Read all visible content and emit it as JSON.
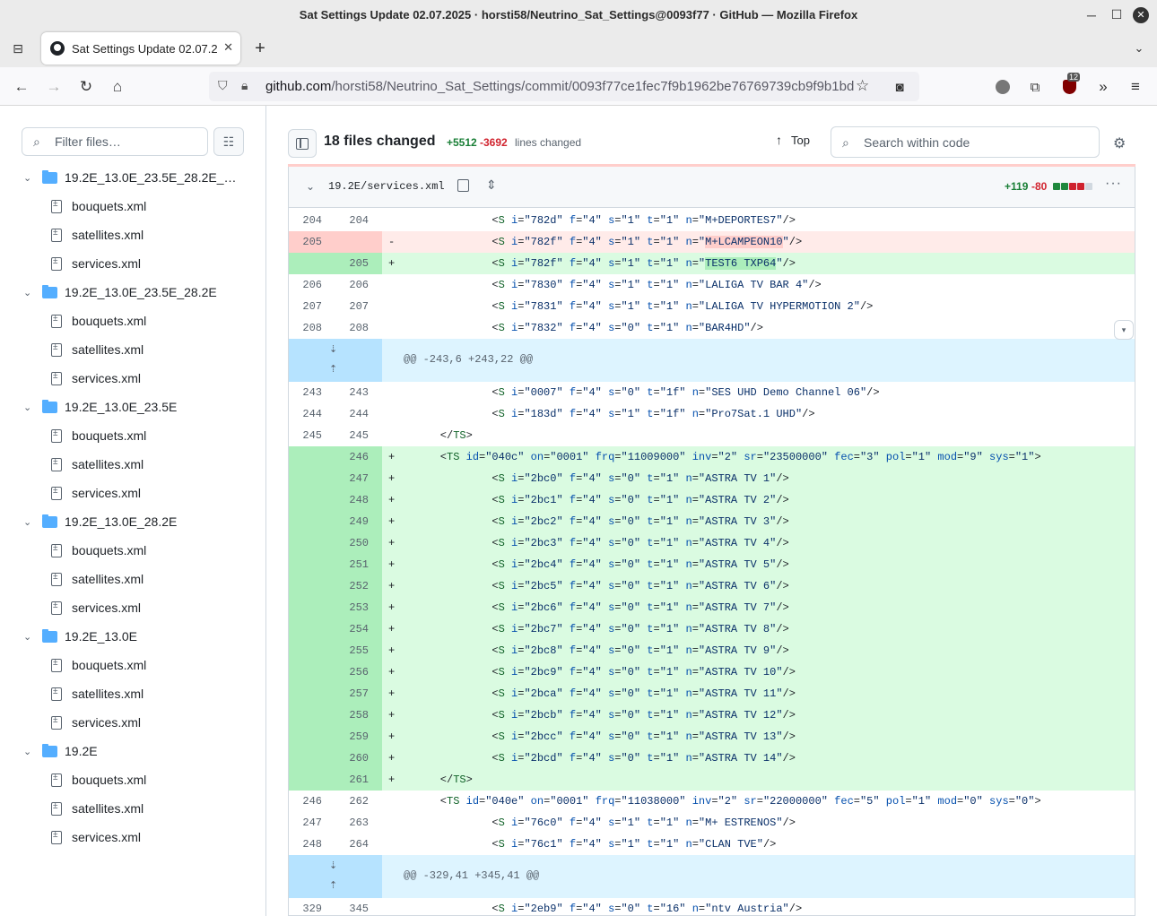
{
  "window": {
    "title": "Sat Settings Update 02.07.2025 · horsti58/Neutrino_Sat_Settings@0093f77 · GitHub — Mozilla Firefox"
  },
  "tab": {
    "title": "Sat Settings Update 02.07.2"
  },
  "url": {
    "host": "github.com",
    "path": "/horsti58/Neutrino_Sat_Settings/commit/0093f77ce1fec7f9b1962be76769739cb9f9b1bd"
  },
  "toolbar": {
    "extensions_badge": "12"
  },
  "sidebar": {
    "filter_placeholder": "Filter files…",
    "folders": [
      {
        "name": "19.2E_13.0E_23.5E_28.2E_…",
        "files": [
          "bouquets.xml",
          "satellites.xml",
          "services.xml"
        ]
      },
      {
        "name": "19.2E_13.0E_23.5E_28.2E",
        "files": [
          "bouquets.xml",
          "satellites.xml",
          "services.xml"
        ]
      },
      {
        "name": "19.2E_13.0E_23.5E",
        "files": [
          "bouquets.xml",
          "satellites.xml",
          "services.xml"
        ]
      },
      {
        "name": "19.2E_13.0E_28.2E",
        "files": [
          "bouquets.xml",
          "satellites.xml",
          "services.xml"
        ]
      },
      {
        "name": "19.2E_13.0E",
        "files": [
          "bouquets.xml",
          "satellites.xml",
          "services.xml"
        ]
      },
      {
        "name": "19.2E",
        "files": [
          "bouquets.xml",
          "satellites.xml",
          "services.xml"
        ]
      }
    ]
  },
  "header": {
    "files_changed": "18 files changed",
    "additions": "+5512",
    "deletions": "-3692",
    "lines_changed": "lines changed",
    "top_label": "Top",
    "search_placeholder": "Search within code"
  },
  "file": {
    "path": "19.2E/services.xml",
    "additions": "+119",
    "deletions": "-80",
    "hunks": [
      {
        "header": "@@ -243,6 +243,22 @@"
      },
      {
        "header": "@@ -329,41 +345,41 @@"
      }
    ]
  },
  "colors": {
    "add_bg": "#dafbe1",
    "del_bg": "#ffebe9",
    "hunk_bg": "#ddf4ff",
    "add_text": "#1a7f37",
    "del_text": "#d1242f"
  },
  "diff": [
    {
      "type": "ctx",
      "o": "204",
      "n": "204",
      "kind": "S",
      "i": "782d",
      "f": "4",
      "s": "1",
      "t": "1",
      "name": "M+DEPORTES7"
    },
    {
      "type": "del",
      "o": "205",
      "n": "",
      "kind": "S",
      "i": "782f",
      "f": "4",
      "s": "1",
      "t": "1",
      "name": "M+LCAMPEON10"
    },
    {
      "type": "add",
      "o": "",
      "n": "205",
      "kind": "S",
      "i": "782f",
      "f": "4",
      "s": "1",
      "t": "1",
      "name": "TEST6 TXP64"
    },
    {
      "type": "ctx",
      "o": "206",
      "n": "206",
      "kind": "S",
      "i": "7830",
      "f": "4",
      "s": "1",
      "t": "1",
      "name": "LALIGA TV BAR 4"
    },
    {
      "type": "ctx",
      "o": "207",
      "n": "207",
      "kind": "S",
      "i": "7831",
      "f": "4",
      "s": "1",
      "t": "1",
      "name": "LALIGA TV HYPERMOTION 2"
    },
    {
      "type": "ctx",
      "o": "208",
      "n": "208",
      "kind": "S",
      "i": "7832",
      "f": "4",
      "s": "0",
      "t": "1",
      "name": "BAR4HD"
    },
    {
      "type": "hunk",
      "idx": 0
    },
    {
      "type": "ctx",
      "o": "243",
      "n": "243",
      "kind": "S",
      "i": "0007",
      "f": "4",
      "s": "0",
      "t": "1f",
      "name": "SES UHD Demo Channel 06"
    },
    {
      "type": "ctx",
      "o": "244",
      "n": "244",
      "kind": "S",
      "i": "183d",
      "f": "4",
      "s": "1",
      "t": "1f",
      "name": "Pro7Sat.1 UHD"
    },
    {
      "type": "ctx",
      "o": "245",
      "n": "245",
      "kind": "TSclose"
    },
    {
      "type": "add",
      "o": "",
      "n": "246",
      "kind": "TS",
      "id": "040c",
      "on": "0001",
      "frq": "11009000",
      "inv": "2",
      "sr": "23500000",
      "fec": "3",
      "pol": "1",
      "mod": "9",
      "sys": "1"
    },
    {
      "type": "add",
      "o": "",
      "n": "247",
      "kind": "S",
      "i": "2bc0",
      "f": "4",
      "s": "0",
      "t": "1",
      "name": "ASTRA TV 1"
    },
    {
      "type": "add",
      "o": "",
      "n": "248",
      "kind": "S",
      "i": "2bc1",
      "f": "4",
      "s": "0",
      "t": "1",
      "name": "ASTRA TV 2"
    },
    {
      "type": "add",
      "o": "",
      "n": "249",
      "kind": "S",
      "i": "2bc2",
      "f": "4",
      "s": "0",
      "t": "1",
      "name": "ASTRA TV 3"
    },
    {
      "type": "add",
      "o": "",
      "n": "250",
      "kind": "S",
      "i": "2bc3",
      "f": "4",
      "s": "0",
      "t": "1",
      "name": "ASTRA TV 4"
    },
    {
      "type": "add",
      "o": "",
      "n": "251",
      "kind": "S",
      "i": "2bc4",
      "f": "4",
      "s": "0",
      "t": "1",
      "name": "ASTRA TV 5"
    },
    {
      "type": "add",
      "o": "",
      "n": "252",
      "kind": "S",
      "i": "2bc5",
      "f": "4",
      "s": "0",
      "t": "1",
      "name": "ASTRA TV 6"
    },
    {
      "type": "add",
      "o": "",
      "n": "253",
      "kind": "S",
      "i": "2bc6",
      "f": "4",
      "s": "0",
      "t": "1",
      "name": "ASTRA TV 7"
    },
    {
      "type": "add",
      "o": "",
      "n": "254",
      "kind": "S",
      "i": "2bc7",
      "f": "4",
      "s": "0",
      "t": "1",
      "name": "ASTRA TV 8"
    },
    {
      "type": "add",
      "o": "",
      "n": "255",
      "kind": "S",
      "i": "2bc8",
      "f": "4",
      "s": "0",
      "t": "1",
      "name": "ASTRA TV 9"
    },
    {
      "type": "add",
      "o": "",
      "n": "256",
      "kind": "S",
      "i": "2bc9",
      "f": "4",
      "s": "0",
      "t": "1",
      "name": "ASTRA TV 10"
    },
    {
      "type": "add",
      "o": "",
      "n": "257",
      "kind": "S",
      "i": "2bca",
      "f": "4",
      "s": "0",
      "t": "1",
      "name": "ASTRA TV 11"
    },
    {
      "type": "add",
      "o": "",
      "n": "258",
      "kind": "S",
      "i": "2bcb",
      "f": "4",
      "s": "0",
      "t": "1",
      "name": "ASTRA TV 12"
    },
    {
      "type": "add",
      "o": "",
      "n": "259",
      "kind": "S",
      "i": "2bcc",
      "f": "4",
      "s": "0",
      "t": "1",
      "name": "ASTRA TV 13"
    },
    {
      "type": "add",
      "o": "",
      "n": "260",
      "kind": "S",
      "i": "2bcd",
      "f": "4",
      "s": "0",
      "t": "1",
      "name": "ASTRA TV 14"
    },
    {
      "type": "add",
      "o": "",
      "n": "261",
      "kind": "TSclose"
    },
    {
      "type": "ctx",
      "o": "246",
      "n": "262",
      "kind": "TS",
      "id": "040e",
      "on": "0001",
      "frq": "11038000",
      "inv": "2",
      "sr": "22000000",
      "fec": "5",
      "pol": "1",
      "mod": "0",
      "sys": "0"
    },
    {
      "type": "ctx",
      "o": "247",
      "n": "263",
      "kind": "S",
      "i": "76c0",
      "f": "4",
      "s": "1",
      "t": "1",
      "name": "M+ ESTRENOS"
    },
    {
      "type": "ctx",
      "o": "248",
      "n": "264",
      "kind": "S",
      "i": "76c1",
      "f": "4",
      "s": "1",
      "t": "1",
      "name": "CLAN TVE"
    },
    {
      "type": "hunk",
      "idx": 1
    },
    {
      "type": "ctx",
      "o": "329",
      "n": "345",
      "kind": "S",
      "i": "2eb9",
      "f": "4",
      "s": "0",
      "t": "16",
      "name": "ntv Austria"
    }
  ]
}
